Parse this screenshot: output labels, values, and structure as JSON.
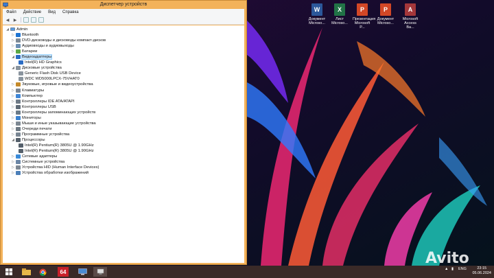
{
  "window": {
    "title": "Диспетчер устройств",
    "menu": [
      "Файл",
      "Действие",
      "Вид",
      "Справка"
    ]
  },
  "tree": {
    "root": "Admin",
    "items": [
      {
        "label": "Bluetooth",
        "level": 1,
        "expanded": false,
        "icon": "bluetooth-icon"
      },
      {
        "label": "DVD-дисководы и дисководы компакт-дисков",
        "level": 1,
        "expanded": false,
        "icon": "dvd-icon"
      },
      {
        "label": "Аудиовходы и аудиовыходы",
        "level": 1,
        "expanded": false,
        "icon": "audio-icon"
      },
      {
        "label": "Батареи",
        "level": 1,
        "expanded": false,
        "icon": "battery-icon"
      },
      {
        "label": "Видеоадаптеры",
        "level": 1,
        "expanded": true,
        "selected": true,
        "icon": "display-adapter-icon"
      },
      {
        "label": "Intel(R) HD Graphics",
        "level": 2,
        "icon": "display-adapter-icon"
      },
      {
        "label": "Дисковые устройства",
        "level": 1,
        "expanded": true,
        "icon": "disk-icon"
      },
      {
        "label": "Generic Flash Disk USB Device",
        "level": 2,
        "icon": "disk-icon"
      },
      {
        "label": "WDC WD5000LPCX-75VHAT0",
        "level": 2,
        "icon": "disk-icon"
      },
      {
        "label": "Звуковые, игровые и видеоустройства",
        "level": 1,
        "expanded": false,
        "icon": "sound-icon"
      },
      {
        "label": "Клавиатуры",
        "level": 1,
        "expanded": false,
        "icon": "keyboard-icon"
      },
      {
        "label": "Компьютер",
        "level": 1,
        "expanded": false,
        "icon": "computer-icon"
      },
      {
        "label": "Контроллеры IDE ATA/ATAPI",
        "level": 1,
        "expanded": false,
        "icon": "controller-icon"
      },
      {
        "label": "Контроллеры USB",
        "level": 1,
        "expanded": false,
        "icon": "usb-icon"
      },
      {
        "label": "Контроллеры запоминающих устройств",
        "level": 1,
        "expanded": false,
        "icon": "storage-controller-icon"
      },
      {
        "label": "Мониторы",
        "level": 1,
        "expanded": false,
        "icon": "monitor-icon"
      },
      {
        "label": "Мыши и иные указывающие устройства",
        "level": 1,
        "expanded": false,
        "icon": "mouse-icon"
      },
      {
        "label": "Очереди печати",
        "level": 1,
        "expanded": false,
        "icon": "printer-icon"
      },
      {
        "label": "Программные устройства",
        "level": 1,
        "expanded": false,
        "icon": "software-device-icon"
      },
      {
        "label": "Процессоры",
        "level": 1,
        "expanded": true,
        "icon": "processor-icon"
      },
      {
        "label": "Intel(R) Pentium(R) 3805U @ 1.90GHz",
        "level": 2,
        "icon": "processor-icon"
      },
      {
        "label": "Intel(R) Pentium(R) 3805U @ 1.90GHz",
        "level": 2,
        "icon": "processor-icon"
      },
      {
        "label": "Сетевые адаптеры",
        "level": 1,
        "expanded": false,
        "icon": "network-icon"
      },
      {
        "label": "Системные устройства",
        "level": 1,
        "expanded": false,
        "icon": "system-device-icon"
      },
      {
        "label": "Устройства HID (Human Interface Devices)",
        "level": 1,
        "expanded": false,
        "icon": "hid-icon"
      },
      {
        "label": "Устройства обработки изображений",
        "level": 1,
        "expanded": false,
        "icon": "imaging-icon"
      }
    ]
  },
  "desktop_icons": [
    {
      "label1": "Документ",
      "label2": "Microso...",
      "color": "#2b579a",
      "glyph": "W"
    },
    {
      "label1": "Лист",
      "label2": "Microso...",
      "color": "#217346",
      "glyph": "X"
    },
    {
      "label1": "Презентация",
      "label2": "Microsoft P...",
      "color": "#d24726",
      "glyph": "P"
    },
    {
      "label1": "Документ",
      "label2": "Microso...",
      "color": "#d24726",
      "glyph": "P"
    },
    {
      "label1": "Microsoft",
      "label2": "Access Ba...",
      "color": "#a4373a",
      "glyph": "A"
    }
  ],
  "taskbar": {
    "app_64_label": "64",
    "lang": "ENG",
    "time": "23:15",
    "date": "05.06.2024"
  },
  "watermark": "Avito",
  "colors": {
    "window_frame": "#f3b25a",
    "selection": "#cce8ff",
    "taskbar": "#3a2a28"
  }
}
